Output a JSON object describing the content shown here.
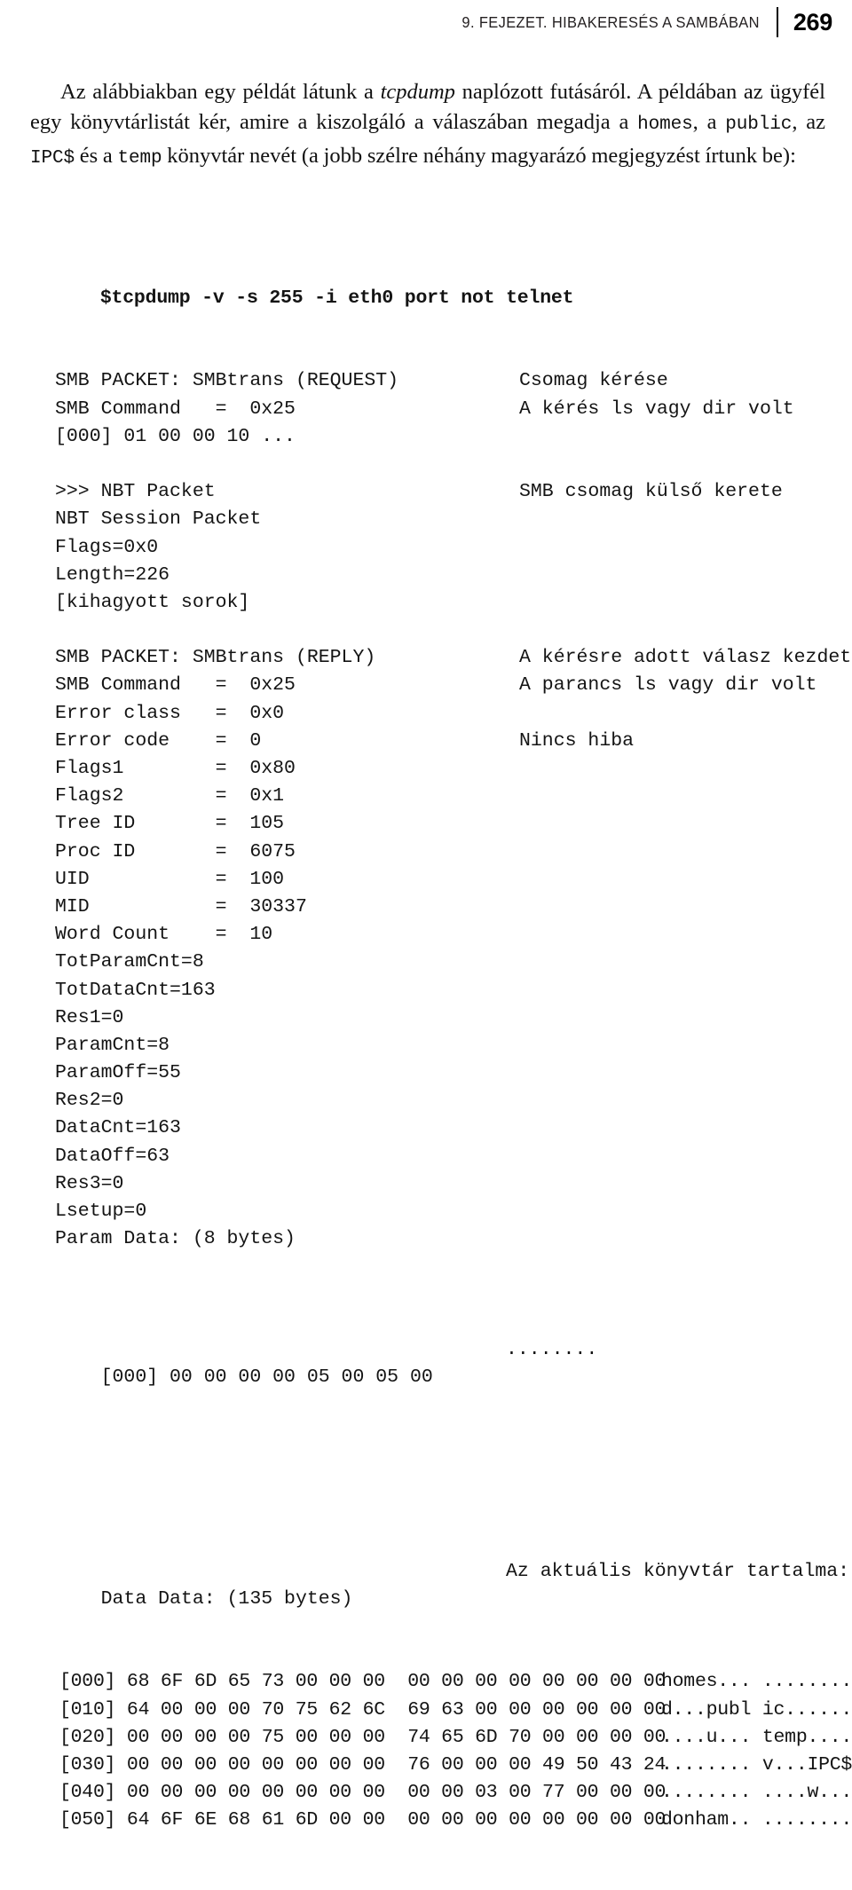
{
  "running_head": {
    "chapter_title": "9. FEJEZET. HIBAKERESÉS A SAMBÁBAN",
    "page_number": "269",
    "rule": "vertical-rule"
  },
  "intro_paragraph": {
    "seg1": "Az alábbiakban egy példát látunk a ",
    "em1": "tcpdump",
    "seg2": " naplózott futásáról. A példában az ügyfél egy könyvtárlistát kér, amire a kiszolgáló a válaszában megadja a ",
    "code1": "homes",
    "seg3": ", a ",
    "code2": "public",
    "seg4": ", az ",
    "code3": "IPC$",
    "seg5": " és a ",
    "code4": "temp",
    "seg6": " könyvtár nevét (a jobb szélre néhány magyarázó megjegyzést írtunk be):"
  },
  "code": {
    "command_line": "$tcpdump -v -s 255 -i eth0 port not telnet",
    "lines": [
      {
        "text": "SMB PACKET: SMBtrans (REQUEST)",
        "note": "Csomag kérése"
      },
      {
        "text": "SMB Command   =  0x25",
        "note": "A kérés ls vagy dir volt"
      },
      {
        "text": "[000] 01 00 00 10 ...",
        "note": ""
      },
      {
        "text": "",
        "note": ""
      },
      {
        "text": ">>> NBT Packet",
        "note": "SMB csomag külső kerete"
      },
      {
        "text": "NBT Session Packet",
        "note": ""
      },
      {
        "text": "Flags=0x0",
        "note": ""
      },
      {
        "text": "Length=226",
        "note": ""
      },
      {
        "text": "[kihagyott sorok]",
        "note": ""
      },
      {
        "text": "",
        "note": ""
      },
      {
        "text": "SMB PACKET: SMBtrans (REPLY)",
        "note": "A kérésre adott válasz kezdete"
      },
      {
        "text": "SMB Command   =  0x25",
        "note": "A parancs ls vagy dir volt"
      },
      {
        "text": "Error class   =  0x0",
        "note": ""
      },
      {
        "text": "Error code    =  0",
        "note": "Nincs hiba"
      },
      {
        "text": "Flags1        =  0x80",
        "note": ""
      },
      {
        "text": "Flags2        =  0x1",
        "note": ""
      },
      {
        "text": "Tree ID       =  105",
        "note": ""
      },
      {
        "text": "Proc ID       =  6075",
        "note": ""
      },
      {
        "text": "UID           =  100",
        "note": ""
      },
      {
        "text": "MID           =  30337",
        "note": ""
      },
      {
        "text": "Word Count    =  10",
        "note": ""
      },
      {
        "text": "TotParamCnt=8",
        "note": ""
      },
      {
        "text": "TotDataCnt=163",
        "note": ""
      },
      {
        "text": "Res1=0",
        "note": ""
      },
      {
        "text": "ParamCnt=8",
        "note": ""
      },
      {
        "text": "ParamOff=55",
        "note": ""
      },
      {
        "text": "Res2=0",
        "note": ""
      },
      {
        "text": "DataCnt=163",
        "note": ""
      },
      {
        "text": "DataOff=63",
        "note": ""
      },
      {
        "text": "Res3=0",
        "note": ""
      },
      {
        "text": "Lsetup=0",
        "note": ""
      },
      {
        "text": "Param Data: (8 bytes)",
        "note": ""
      }
    ],
    "param_hex_line": {
      "text": "[000] 00 00 00 00 05 00 05 00",
      "note": "........"
    },
    "data_header": {
      "text": "Data Data: (135 bytes)",
      "note": "Az aktuális könyvtár tartalma:"
    },
    "hexdump": [
      {
        "text": "[000] 68 6F 6D 65 73 00 00 00  00 00 00 00 00 00 00 00",
        "note": "homes... ........"
      },
      {
        "text": "[010] 64 00 00 00 70 75 62 6C  69 63 00 00 00 00 00 00",
        "note": "d...publ ic......"
      },
      {
        "text": "[020] 00 00 00 00 75 00 00 00  74 65 6D 70 00 00 00 00",
        "note": "....u... temp...."
      },
      {
        "text": "[030] 00 00 00 00 00 00 00 00  76 00 00 00 49 50 43 24",
        "note": "........ v...IPC$"
      },
      {
        "text": "[040] 00 00 00 00 00 00 00 00  00 00 03 00 77 00 00 00",
        "note": "........ ....w..."
      },
      {
        "text": "[050] 64 6F 6E 68 61 6D 00 00  00 00 00 00 00 00 00 00",
        "note": "donham.. ........"
      }
    ]
  }
}
